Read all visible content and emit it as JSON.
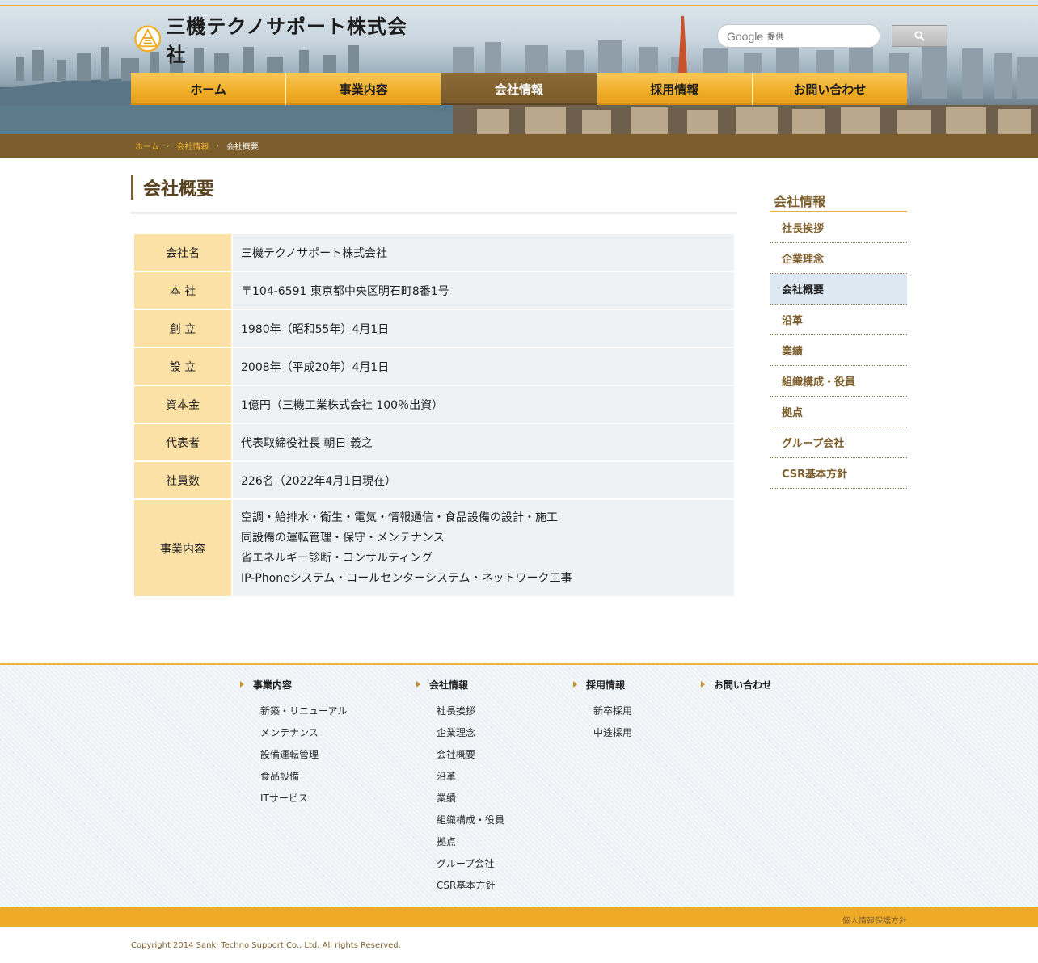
{
  "site": {
    "logo_text": "三機テクノサポート株式会社",
    "accent": "#f0ae2a",
    "brown": "#7c5e2c"
  },
  "search": {
    "brand": "Google",
    "provided": "提供",
    "placeholder": ""
  },
  "nav": [
    "ホーム",
    "事業内容",
    "会社情報",
    "採用情報",
    "お問い合わせ"
  ],
  "nav_active": "会社情報",
  "breadcrumb": {
    "home": "ホーム",
    "section": "会社情報",
    "current": "会社概要"
  },
  "page_title": "会社概要",
  "company_info": [
    {
      "label": "会社名",
      "value": "三機テクノサポート株式会社"
    },
    {
      "label": "本 社",
      "value": "〒104-6591 東京都中央区明石町8番1号"
    },
    {
      "label": "創 立",
      "value": "1980年（昭和55年）4月1日"
    },
    {
      "label": "設 立",
      "value": "2008年（平成20年）4月1日"
    },
    {
      "label": "資本金",
      "value": "1億円（三機工業株式会社 100％出資）"
    },
    {
      "label": "代表者",
      "value": "代表取締役社長 朝日 義之"
    },
    {
      "label": "社員数",
      "value": "226名（2022年4月1日現在）"
    },
    {
      "label": "事業内容",
      "lines": [
        "空調・給排水・衛生・電気・情報通信・食品設備の設計・施工",
        "同設備の運転管理・保守・メンテナンス",
        "省エネルギー診断・コンサルティング",
        "IP-Phoneシステム・コールセンターシステム・ネットワーク工事"
      ]
    }
  ],
  "sidebar": {
    "title": "会社情報",
    "items": [
      "社長挨拶",
      "企業理念",
      "会社概要",
      "沿革",
      "業績",
      "組織構成・役員",
      "拠点",
      "グループ会社",
      "CSR基本方針"
    ],
    "active": "会社概要"
  },
  "footer": {
    "columns": [
      {
        "head": "事業内容",
        "items": [
          "新築・リニューアル",
          "メンテナンス",
          "設備運転管理",
          "食品設備",
          "ITサービス"
        ]
      },
      {
        "head": "会社情報",
        "items": [
          "社長挨拶",
          "企業理念",
          "会社概要",
          "沿革",
          "業績",
          "組織構成・役員",
          "拠点",
          "グループ会社",
          "CSR基本方針"
        ]
      },
      {
        "head": "採用情報",
        "items": [
          "新卒採用",
          "中途採用"
        ]
      },
      {
        "head": "お問い合わせ",
        "items": []
      }
    ],
    "privacy": "個人情報保護方針",
    "copyright": "Copyright 2014 Sanki Techno Support Co., Ltd. All rights Reserved."
  }
}
